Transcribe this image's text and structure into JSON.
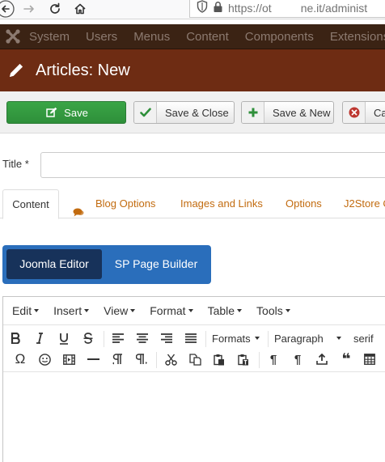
{
  "browser": {
    "url_prefix": "https://ot",
    "url_middle": "ne.it/administ",
    "icons": [
      "back-arrow-icon",
      "forward-arrow-icon",
      "reload-icon",
      "home-icon",
      "shield-icon",
      "lock-icon"
    ]
  },
  "admin_menu": {
    "items": [
      "System",
      "Users",
      "Menus",
      "Content",
      "Components",
      "Extensions"
    ]
  },
  "page": {
    "title": "Articles: New"
  },
  "toolbar": {
    "save_label": "Save",
    "save_close_label": "Save & Close",
    "save_new_label": "Save & New",
    "cancel_label": "Ca"
  },
  "form": {
    "title_label": "Title *",
    "title_value": ""
  },
  "tabs": [
    "Content",
    "Blog Options",
    "Images and Links",
    "Options",
    "J2Store C"
  ],
  "editor_switch": {
    "active": "Joomla Editor",
    "other": "SP Page Builder"
  },
  "editor": {
    "menubar": [
      "Edit",
      "Insert",
      "View",
      "Format",
      "Table",
      "Tools"
    ],
    "formats_label": "Formats",
    "paragraph_label": "Paragraph",
    "font_label": "serif",
    "omega_glyph": "Ω",
    "pilcrow_glyph": "¶",
    "quote_glyph": "❝"
  },
  "colors": {
    "admin_menu_bg": "#3b2314",
    "title_bar_bg": "#6e2c13",
    "save_green": "#3aa546",
    "tab_link": "#c26b0f",
    "editor_switch_bg": "#2a6ebb",
    "editor_switch_active": "#17325a"
  }
}
